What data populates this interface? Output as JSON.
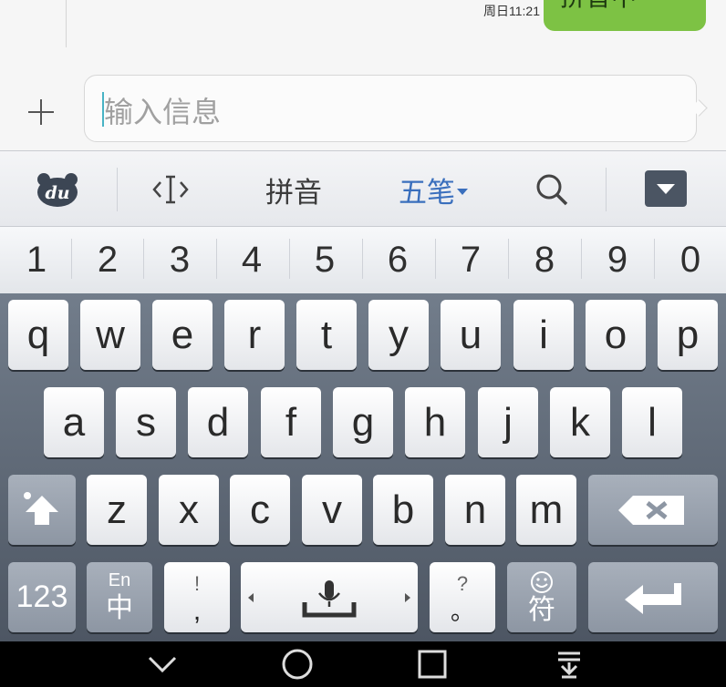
{
  "chat": {
    "time": "周日11:21",
    "bubble_text": "拼音中"
  },
  "input": {
    "placeholder": "输入信息"
  },
  "toolbar": {
    "logo": "du",
    "mode_pinyin": "拼音",
    "mode_wubi": "五笔"
  },
  "numbers": [
    "1",
    "2",
    "3",
    "4",
    "5",
    "6",
    "7",
    "8",
    "9",
    "0"
  ],
  "keys": {
    "row1": [
      "q",
      "w",
      "e",
      "r",
      "t",
      "y",
      "u",
      "i",
      "o",
      "p"
    ],
    "row2": [
      "a",
      "s",
      "d",
      "f",
      "g",
      "h",
      "j",
      "k",
      "l"
    ],
    "row3": [
      "z",
      "x",
      "c",
      "v",
      "b",
      "n",
      "m"
    ],
    "num_key": "123",
    "lang_top": "En",
    "lang_bottom": "中",
    "punct_left_top": "!",
    "punct_left_bottom": ",",
    "punct_right_top": "?",
    "punct_right_bottom": "。",
    "symbol_key": "符"
  },
  "icons": {
    "shift": "shift-icon",
    "backspace": "backspace-icon",
    "mic": "microphone-icon",
    "enter": "enter-icon",
    "emoji": "emoji-icon",
    "hide": "hide-keyboard-icon"
  },
  "colors": {
    "bubble": "#7dc244",
    "accent": "#3a6fbd",
    "caret": "#48b3c5"
  }
}
